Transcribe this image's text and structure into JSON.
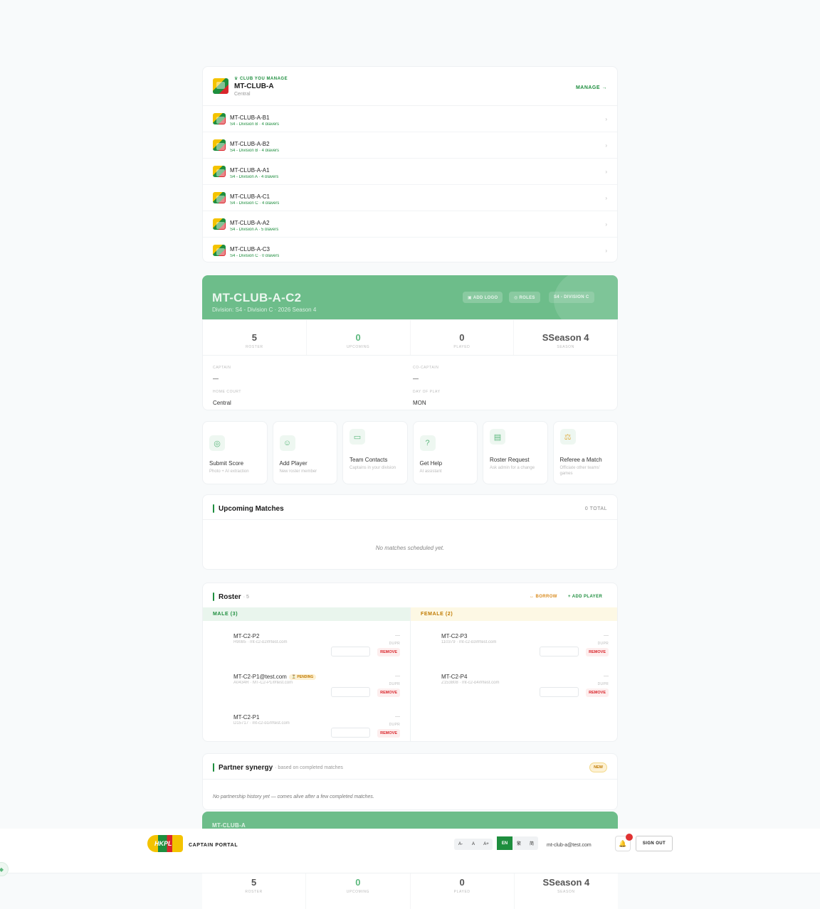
{
  "club": {
    "tag": "♛ CLUB YOU MANAGE",
    "name": "MT-CLUB-A",
    "region": "Central",
    "manage_label": "MANAGE →",
    "teams": [
      {
        "name": "MT-CLUB-A-B1",
        "sub": "S4 - Division B · 4 players"
      },
      {
        "name": "MT-CLUB-A-B2",
        "sub": "S4 - Division B · 4 players"
      },
      {
        "name": "MT-CLUB-A-A1",
        "sub": "S4 - Division A · 4 players"
      },
      {
        "name": "MT-CLUB-A-C1",
        "sub": "S4 - Division C · 4 players"
      },
      {
        "name": "MT-CLUB-A-A2",
        "sub": "S4 - Division A · 5 players"
      },
      {
        "name": "MT-CLUB-A-C3",
        "sub": "S4 - Division C · 0 players"
      }
    ]
  },
  "team": {
    "name": "MT-CLUB-A-C2",
    "subtitle": "Division: S4 - Division C · 2026 Season 4",
    "add_logo": "▣ ADD LOGO",
    "roles": "◎ ROLES",
    "division_badge": "S4 - DIVISION C",
    "stats": [
      {
        "value": "5",
        "label": "ROSTER"
      },
      {
        "value": "0",
        "label": "UPCOMING"
      },
      {
        "value": "0",
        "label": "PLAYED"
      },
      {
        "value": "SSeason 4",
        "label": "SEASON"
      }
    ],
    "captain_label": "CAPTAIN",
    "captain_value": "—",
    "cocaptain_label": "CO-CAPTAIN",
    "cocaptain_value": "—",
    "court_label": "HOME COURT",
    "court_value": "Central",
    "day_label": "DAY OF PLAY",
    "day_value": "MON"
  },
  "actions": [
    {
      "title": "Submit Score",
      "sub": "Photo + AI extraction",
      "icon": "camera-icon"
    },
    {
      "title": "Add Player",
      "sub": "New roster member",
      "icon": "user-plus-icon"
    },
    {
      "title": "Team Contacts",
      "sub": "Captains in your division",
      "icon": "chat-icon"
    },
    {
      "title": "Get Help",
      "sub": "AI assistant",
      "icon": "help-icon"
    },
    {
      "title": "Roster Request",
      "sub": "Ask admin for a change",
      "icon": "clipboard-icon"
    },
    {
      "title": "Referee a Match",
      "sub": "Officiate other teams' games",
      "icon": "scale-icon"
    }
  ],
  "upcoming": {
    "title": "Upcoming Matches",
    "total": "0 TOTAL",
    "empty": "No matches scheduled yet."
  },
  "roster": {
    "title": "Roster",
    "count": "· 5",
    "borrow": "↔ BORROW",
    "add_player": "+ ADD PLAYER",
    "male_header": "MALE (3)",
    "female_header": "FEMALE (2)",
    "dash": "—",
    "dupr": "DUPR",
    "remove": "REMOVE",
    "pending": "⏳ PENDING",
    "male": [
      {
        "name": "MT-C2-P2",
        "email": "H9085 · mt-c2-p2@test.com"
      },
      {
        "name": "MT-C2-P1@test.com",
        "email": "A0434R · MT-C2-P1@test.com"
      },
      {
        "name": "MT-C2-P1",
        "email": "D15717 · mt-c2-p1@test.com"
      }
    ],
    "female": [
      {
        "name": "MT-C2-P3",
        "email": "110379 · mt-c2-p3@test.com"
      },
      {
        "name": "MT-C2-P4",
        "email": "Z153808 · mt-c2-p4@test.com"
      }
    ]
  },
  "synergy": {
    "title": "Partner synergy",
    "subtitle": "· based on completed matches",
    "badge": "NEW",
    "empty": "No partnership history yet — comes alive after a few completed matches."
  },
  "next_team": {
    "name": "MT-CLUB-A"
  },
  "header": {
    "brand": "HKPL",
    "portal": "CAPTAIN PORTAL",
    "font_sizes": [
      "A-",
      "A",
      "A+"
    ],
    "languages": [
      "EN",
      "繁",
      "简"
    ],
    "email": "mt-club-a@test.com",
    "sign_out": "SIGN OUT"
  },
  "colors": {
    "brand_green": "#1e8e3e",
    "hero_green": "#6dbd8a",
    "danger": "#d9262c"
  }
}
